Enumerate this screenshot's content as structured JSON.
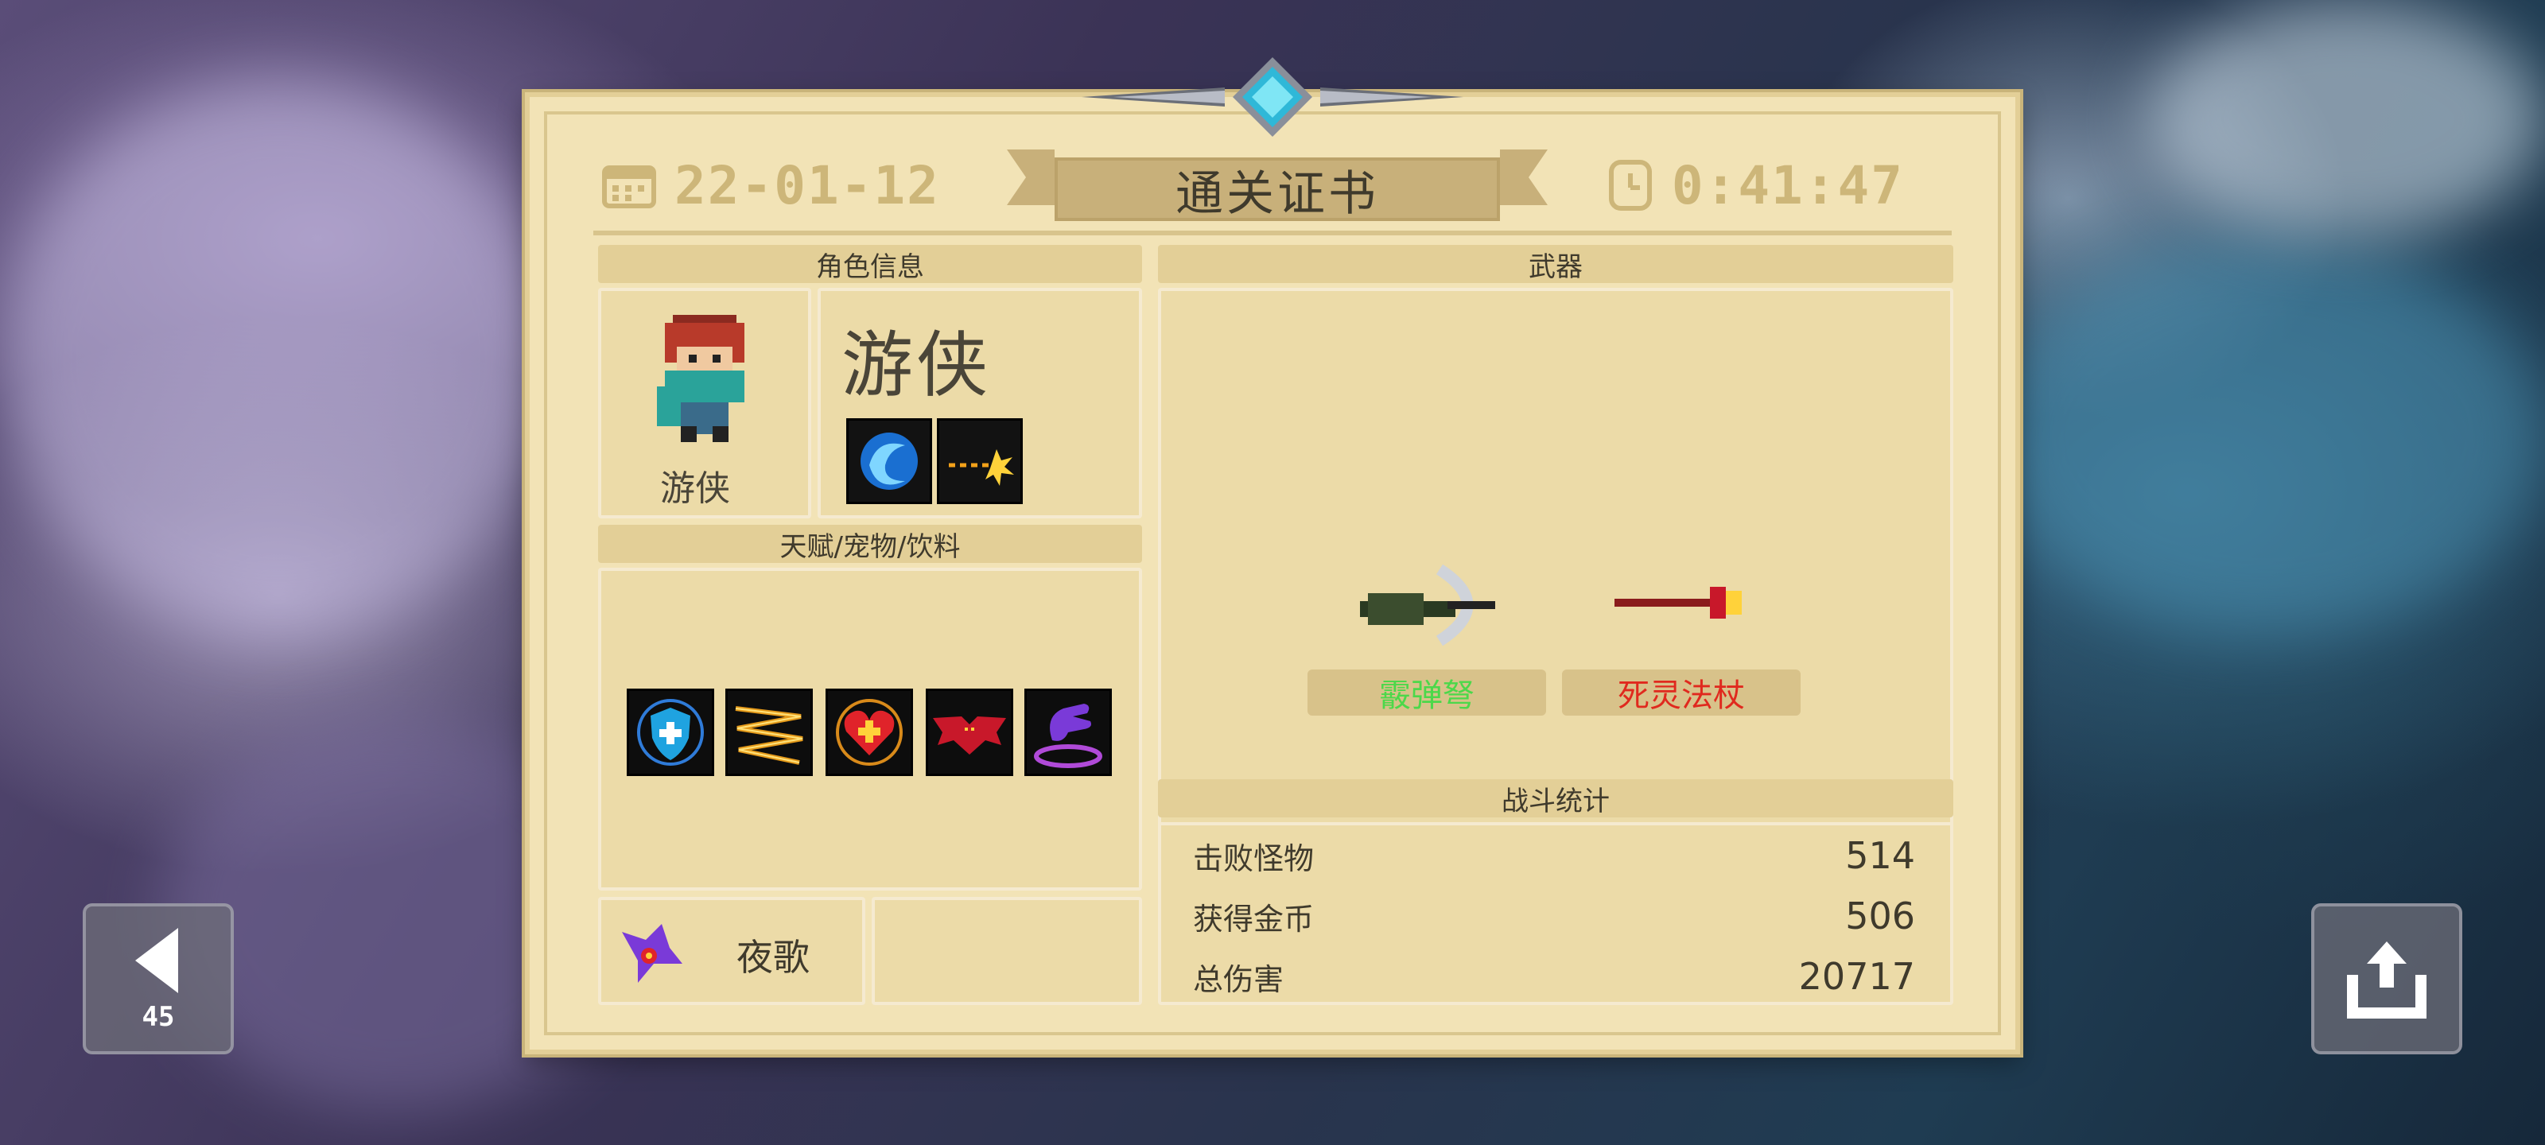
{
  "header": {
    "date": "22-01-12",
    "title": "通关证书",
    "time": "0:41:47"
  },
  "character": {
    "section_title": "角色信息",
    "name_large": "游侠",
    "name_small": "游侠",
    "skills": [
      "dodge-swirl-icon",
      "explosive-shot-icon"
    ]
  },
  "talents": {
    "section_title": "天赋/宠物/饮料",
    "items": [
      "shield-plus-icon",
      "lightning-icon",
      "heart-plus-icon",
      "bat-wings-icon",
      "purple-hand-icon"
    ]
  },
  "pet": {
    "name": "夜歌",
    "icon": "purple-bird-icon"
  },
  "weapons": {
    "section_title": "武器",
    "items": [
      {
        "name": "霰弹弩",
        "color": "#4cd84a",
        "icon": "crossbow-icon"
      },
      {
        "name": "死灵法杖",
        "color": "#e0291e",
        "icon": "necro-staff-icon"
      }
    ]
  },
  "battle_stats": {
    "section_title": "战斗统计",
    "rows": [
      {
        "label": "击败怪物",
        "value": "514"
      },
      {
        "label": "获得金币",
        "value": "506"
      },
      {
        "label": "总伤害",
        "value": "20717"
      }
    ]
  },
  "buttons": {
    "back_count": "45"
  }
}
